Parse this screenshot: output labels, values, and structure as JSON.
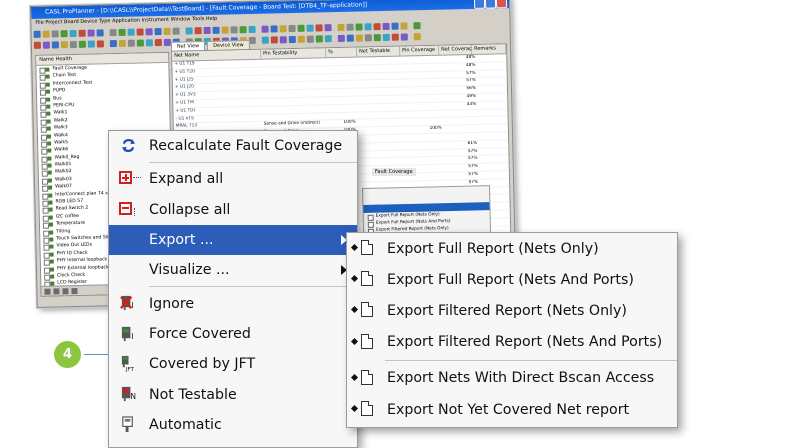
{
  "app": {
    "title": "CASL ProPlanner - [D:\\\\CASL\\\\ProjectData\\\\TestBoard] - [Fault Coverage - Board Test: [DTB4_TF-application]]",
    "menubar": "File  Project  Board  Device Type  Application  Instrument  Window  Tools  Help",
    "left_header": "Name                              Health",
    "tabs": [
      "Net View",
      "Device View"
    ],
    "grid_headers": [
      "Net Name",
      "Pin Testability",
      "%",
      "Net Testable",
      "Pin Coverage",
      "Net Coverage",
      "Remarks"
    ],
    "tree_rows": [
      "Fault Coverage",
      "Chain Test",
      "Interconnect Test",
      "PUPD",
      "Bus",
      "PERI-CPU",
      "Walk1",
      "Walk2",
      "Walk3",
      "Walk4",
      "Walk5",
      "Walk6",
      "Walk0_Reg",
      "Walk01",
      "Walk02",
      "Walk03",
      "Walk07",
      "InterConnect plan 74 xCont",
      "RGB LED 57",
      "Read Switch 2",
      "I2C coffee",
      "Temperature",
      "Tilting",
      "Touch Switches and Slider",
      "Video Out LEDs",
      "PHY ID Check",
      "PHY Internal loopback",
      "PHY External loopback",
      "Clock Check",
      "LCD Register",
      "Check",
      "I/O",
      "Core HTST",
      "ADC Voltage Check",
      "Configure detection at speed"
    ],
    "grid_rows": [
      [
        "+ U1  T19",
        "",
        "",
        "",
        "",
        "48%",
        ""
      ],
      [
        "+ U1  T20",
        "",
        "",
        "",
        "",
        "48%",
        ""
      ],
      [
        "+ U1  J25",
        "",
        "",
        "",
        "",
        "57%",
        ""
      ],
      [
        "+ U1  J20",
        "",
        "",
        "",
        "",
        "57%",
        ""
      ],
      [
        "+ U1  3V3",
        "",
        "",
        "",
        "",
        "56%",
        ""
      ],
      [
        "+ U1  TM",
        "",
        "",
        "",
        "",
        "49%",
        ""
      ],
      [
        "+ U1  TDI",
        "",
        "",
        "",
        "",
        "43%",
        ""
      ],
      [
        "- U1  nTS",
        "",
        "",
        "",
        "",
        "",
        ""
      ],
      [
        "    MRAL  T13",
        "Sense and Drive (indirect)",
        "100%",
        "",
        "",
        "",
        ""
      ],
      [
        "    U1C2  E10 R1070",
        "Sense and Drive",
        "100%",
        "",
        "100%",
        "",
        ""
      ],
      [
        "    U1C2  H19 R1021",
        "Sense (indirect)",
        "100%",
        "",
        "",
        "",
        ""
      ],
      [
        "+ U1",
        "",
        "",
        "",
        "",
        "61%",
        ""
      ],
      [
        "+ U1",
        "",
        "",
        "",
        "",
        "57%",
        ""
      ],
      [
        "+ U1",
        "",
        "",
        "",
        "",
        "57%",
        ""
      ],
      [
        "+ U1",
        "",
        "",
        "",
        "",
        "57%",
        ""
      ],
      [
        "+ U1",
        "",
        "",
        "",
        "",
        "57%",
        ""
      ],
      [
        "+ U1",
        "",
        "",
        "",
        "",
        "57%",
        ""
      ],
      [
        "+ U1",
        "",
        "",
        "",
        "",
        "57%",
        ""
      ],
      [
        "+ U1",
        "",
        "",
        "",
        "",
        "57%",
        ""
      ],
      [
        "+ U1",
        "",
        "",
        "",
        "",
        "57%",
        ""
      ],
      [
        "+ U1",
        "",
        "",
        "",
        "",
        "57%",
        ""
      ],
      [
        "+ U1",
        "",
        "",
        "",
        "",
        "57%",
        ""
      ]
    ],
    "mini_menu_label": "Fault Coverage",
    "mini_menu_items": [
      "Export Full Report (Nets Only)",
      "Export Full Report (Nets And Ports)",
      "Export Filtered Report (Nets Only)",
      "Export Filtered Report (Nets And Ports)"
    ]
  },
  "context_menu": {
    "items": [
      {
        "name": "recalculate-fault-coverage",
        "label": "Recalculate Fault Coverage",
        "icon": "refresh-arrows-icon"
      },
      {
        "name": "expand-all",
        "label": "Expand all",
        "icon": "expand-tree-icon"
      },
      {
        "name": "collapse-all",
        "label": "Collapse all",
        "icon": "collapse-tree-icon"
      },
      {
        "name": "export",
        "label": "Export ...",
        "icon": "",
        "submenu": true,
        "highlighted": true
      },
      {
        "name": "visualize",
        "label": "Visualize ...",
        "icon": "",
        "submenu": true
      },
      {
        "name": "ignore",
        "label": "Ignore",
        "icon": "ignore-pin-icon"
      },
      {
        "name": "force-covered",
        "label": "Force Covered",
        "icon": "force-covered-pin-icon"
      },
      {
        "name": "covered-by-jft",
        "label": "Covered by JFT",
        "icon": "jft-pin-icon"
      },
      {
        "name": "not-testable",
        "label": "Not Testable",
        "icon": "not-testable-pin-icon"
      },
      {
        "name": "automatic",
        "label": "Automatic",
        "icon": "automatic-pin-icon"
      }
    ]
  },
  "export_submenu": {
    "items": [
      {
        "name": "export-full-nets",
        "label": "Export Full Report (Nets Only)"
      },
      {
        "name": "export-full-nets-ports",
        "label": "Export Full Report (Nets And Ports)"
      },
      {
        "name": "export-filtered-nets",
        "label": "Export Filtered Report (Nets Only)"
      },
      {
        "name": "export-filtered-nets-ports",
        "label": "Export Filtered Report (Nets And Ports)"
      },
      {
        "name": "export-direct-bscan",
        "label": "Export Nets With Direct Bscan Access"
      },
      {
        "name": "export-not-covered",
        "label": "Export Not Yet Covered Net report"
      }
    ]
  },
  "callout": {
    "number": "4"
  },
  "colors": {
    "highlight": "#2c5db8",
    "callout": "#8cc63f",
    "callout_line": "#5a8fc9",
    "icon_red": "#d21f1f"
  }
}
